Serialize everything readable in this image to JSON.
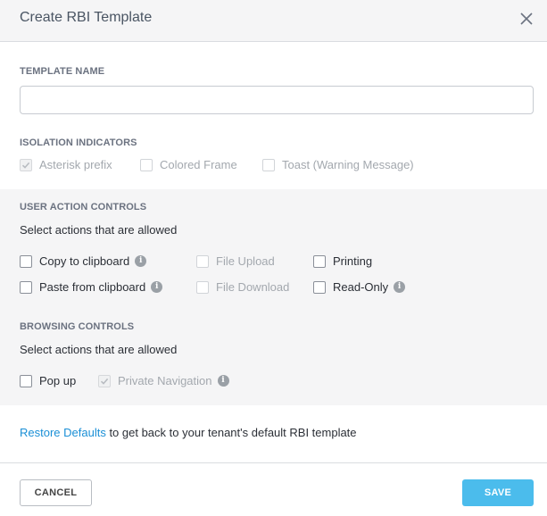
{
  "header": {
    "title": "Create RBI Template",
    "close_icon": "close-icon"
  },
  "template_name": {
    "label": "TEMPLATE NAME",
    "value": "",
    "placeholder": ""
  },
  "isolation": {
    "label": "ISOLATION INDICATORS",
    "options": [
      {
        "label": "Asterisk prefix",
        "checked": true,
        "disabled": true
      },
      {
        "label": "Colored Frame",
        "checked": false,
        "disabled": true
      },
      {
        "label": "Toast (Warning Message)",
        "checked": false,
        "disabled": true
      }
    ]
  },
  "user_actions": {
    "label": "USER ACTION CONTROLS",
    "description": "Select actions that are allowed",
    "options": [
      {
        "label": "Copy to clipboard",
        "checked": false,
        "disabled": false,
        "info": true
      },
      {
        "label": "Paste from clipboard",
        "checked": false,
        "disabled": false,
        "info": true
      },
      {
        "label": "File Upload",
        "checked": false,
        "disabled": true,
        "info": false
      },
      {
        "label": "File Download",
        "checked": false,
        "disabled": true,
        "info": false
      },
      {
        "label": "Printing",
        "checked": false,
        "disabled": false,
        "info": false
      },
      {
        "label": "Read-Only",
        "checked": false,
        "disabled": false,
        "info": true
      }
    ]
  },
  "browsing": {
    "label": "BROWSING CONTROLS",
    "description": "Select actions that are allowed",
    "options": [
      {
        "label": "Pop up",
        "checked": false,
        "disabled": false,
        "info": false
      },
      {
        "label": "Private Navigation",
        "checked": true,
        "disabled": true,
        "info": true
      }
    ]
  },
  "restore": {
    "link": "Restore Defaults",
    "text": " to get back to your tenant's default RBI template"
  },
  "footer": {
    "cancel_label": "CANCEL",
    "save_label": "SAVE"
  },
  "colors": {
    "accent": "#4bbcec",
    "link": "#1a8fd6",
    "band": "#f5f5f6"
  }
}
